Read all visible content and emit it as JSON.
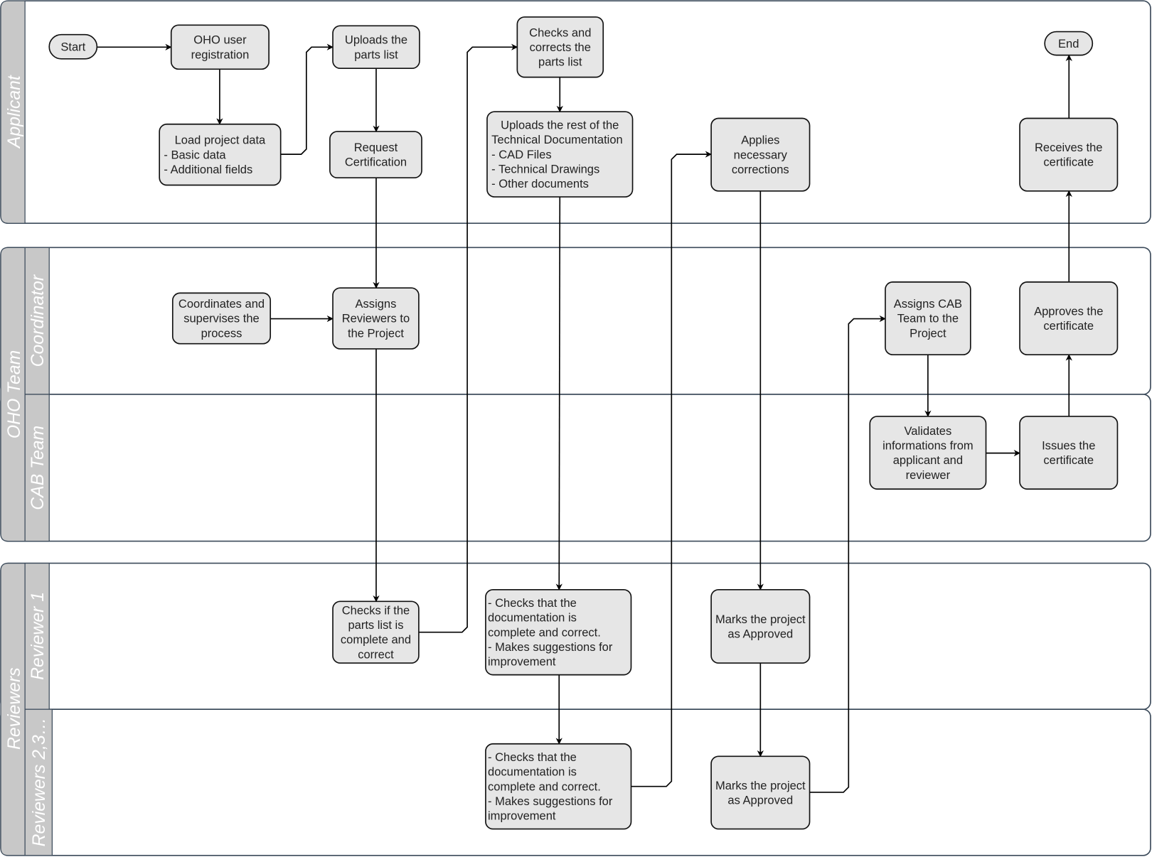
{
  "lanes": {
    "applicant": "Applicant",
    "oho_team": "OHO Team",
    "coordinator": "Coordinator",
    "cab_team": "CAB Team",
    "reviewers": "Reviewers",
    "reviewer_1": "Reviewer 1",
    "reviewers_2_3": "Reviewers 2,3…"
  },
  "nodes": {
    "start": {
      "lines": [
        "Start"
      ]
    },
    "oho_user_registration": {
      "lines": [
        "OHO user",
        "registration"
      ]
    },
    "load_project_data": {
      "lines": [
        "Load project data",
        "- Basic data",
        "- Additional fields"
      ]
    },
    "uploads_parts_list": {
      "lines": [
        "Uploads the",
        "parts list"
      ]
    },
    "request_certification": {
      "lines": [
        "Request",
        "Certification"
      ]
    },
    "checks_corrects_parts_list": {
      "lines": [
        "Checks and",
        "corrects the",
        "parts list"
      ]
    },
    "uploads_rest_docs": {
      "lines": [
        "Uploads the rest of the",
        "Technical Documentation",
        "- CAD Files",
        "- Technical Drawings",
        "- Other documents"
      ]
    },
    "applies_corrections": {
      "lines": [
        "Applies",
        "necessary",
        "corrections"
      ]
    },
    "end": {
      "lines": [
        "End"
      ]
    },
    "receives_certificate": {
      "lines": [
        "Receives the",
        "certificate"
      ]
    },
    "coordinates_supervises": {
      "lines": [
        "Coordinates and",
        "supervises the",
        "process"
      ]
    },
    "assigns_reviewers": {
      "lines": [
        "Assigns",
        "Reviewers to",
        "the Project"
      ]
    },
    "assigns_cab_team": {
      "lines": [
        "Assigns CAB",
        "Team to the",
        "Project"
      ]
    },
    "approves_certificate": {
      "lines": [
        "Approves the",
        "certificate"
      ]
    },
    "validates_information": {
      "lines": [
        "Validates",
        "informations from",
        "applicant and",
        "reviewer"
      ]
    },
    "issues_certificate": {
      "lines": [
        "Issues the",
        "certificate"
      ]
    },
    "checks_parts_list": {
      "lines": [
        "Checks if the",
        "parts list is",
        "complete and",
        "correct"
      ]
    },
    "checks_documentation_r1": {
      "lines": [
        "- Checks that the",
        "documentation is",
        "complete and correct.",
        "- Makes suggestions for",
        "improvement"
      ]
    },
    "marks_approved_r1": {
      "lines": [
        "Marks the project",
        "as Approved"
      ]
    },
    "checks_documentation_r2": {
      "lines": [
        "- Checks that the",
        "documentation is",
        "complete and correct.",
        "- Makes suggestions for",
        "improvement"
      ]
    },
    "marks_approved_r2": {
      "lines": [
        "Marks the project",
        "as Approved"
      ]
    }
  },
  "edges": [
    [
      "start",
      "oho_user_registration"
    ],
    [
      "oho_user_registration",
      "load_project_data"
    ],
    [
      "load_project_data",
      "uploads_parts_list"
    ],
    [
      "uploads_parts_list",
      "request_certification"
    ],
    [
      "request_certification",
      "assigns_reviewers"
    ],
    [
      "coordinates_supervises",
      "assigns_reviewers"
    ],
    [
      "assigns_reviewers",
      "checks_parts_list"
    ],
    [
      "checks_parts_list",
      "checks_corrects_parts_list"
    ],
    [
      "checks_corrects_parts_list",
      "uploads_rest_docs"
    ],
    [
      "uploads_rest_docs",
      "checks_documentation_r1"
    ],
    [
      "checks_documentation_r1",
      "checks_documentation_r2"
    ],
    [
      "checks_documentation_r2",
      "applies_corrections"
    ],
    [
      "applies_corrections",
      "marks_approved_r1"
    ],
    [
      "marks_approved_r1",
      "marks_approved_r2"
    ],
    [
      "marks_approved_r2",
      "assigns_cab_team"
    ],
    [
      "assigns_cab_team",
      "validates_information"
    ],
    [
      "validates_information",
      "issues_certificate"
    ],
    [
      "issues_certificate",
      "approves_certificate"
    ],
    [
      "approves_certificate",
      "receives_certificate"
    ],
    [
      "receives_certificate",
      "end"
    ]
  ]
}
